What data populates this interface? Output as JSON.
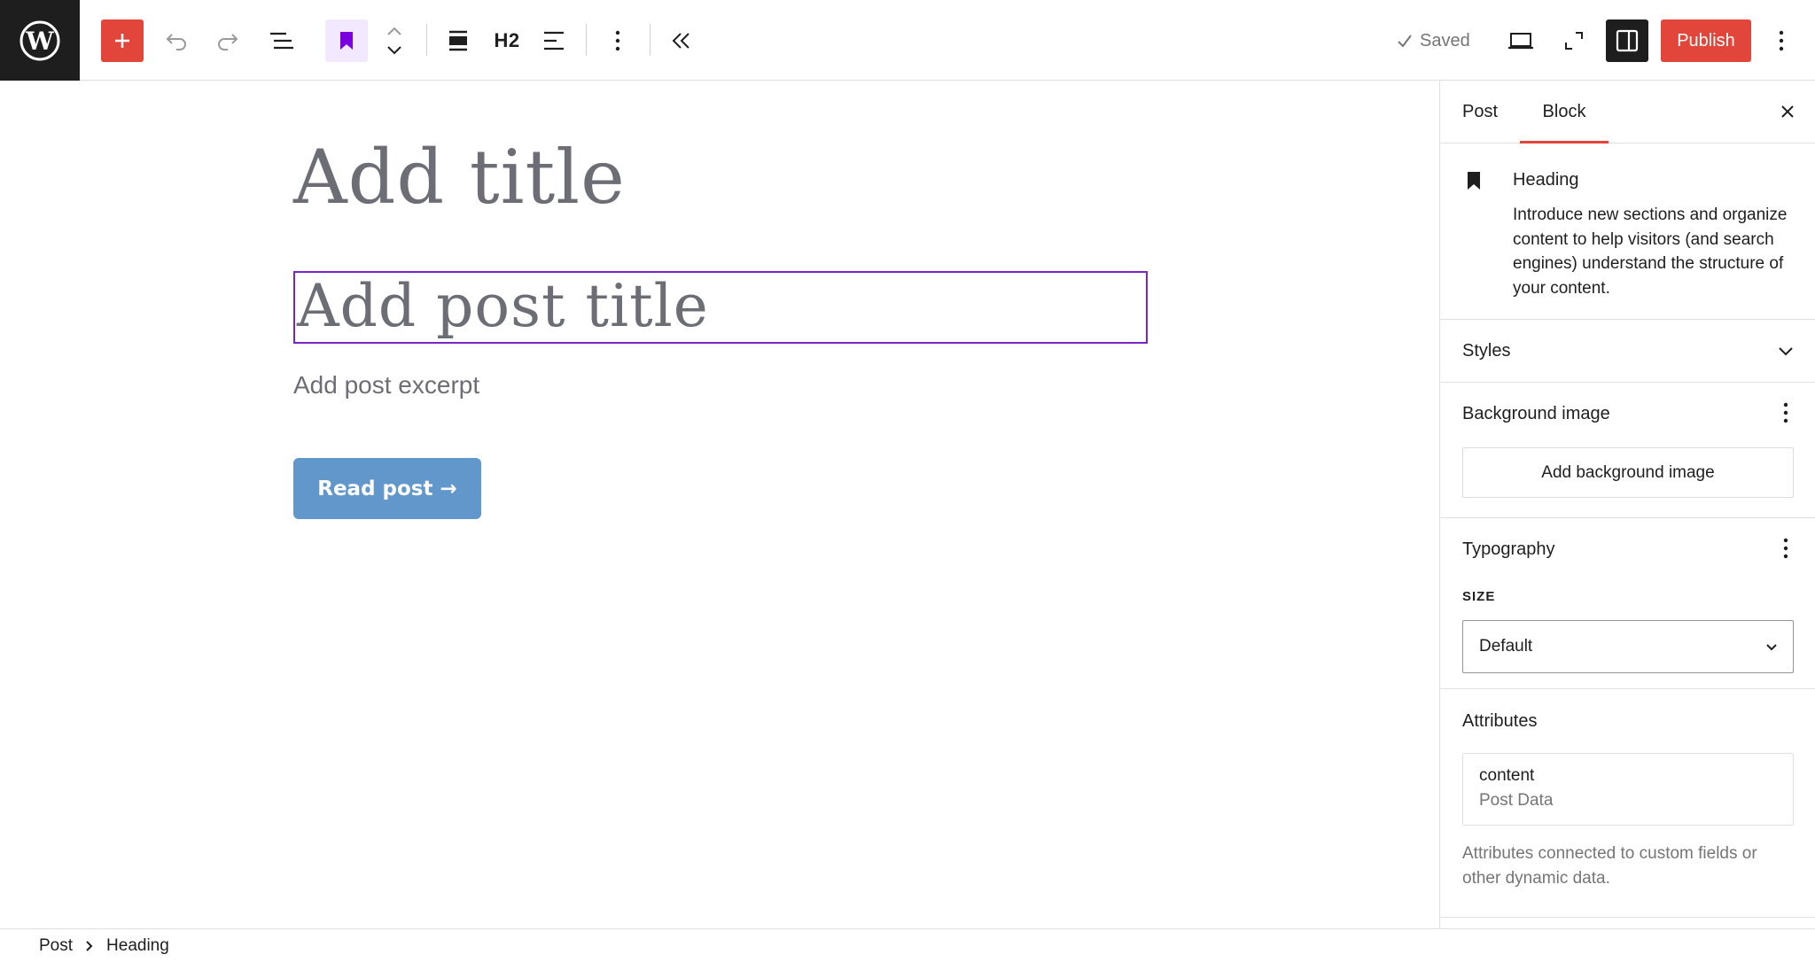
{
  "toolbar": {
    "add_block_icon": "plus-icon",
    "undo_icon": "undo-icon",
    "redo_icon": "redo-icon",
    "document_overview_icon": "list-view-icon",
    "block_type_icon": "bookmark-icon",
    "heading_level": "H2",
    "saved_label": "Saved",
    "publish_label": "Publish",
    "accent_color": "#e2463a"
  },
  "editor": {
    "title_placeholder": "Add title",
    "heading_placeholder": "Add post title",
    "excerpt_placeholder": "Add post excerpt",
    "read_button_label": "Read post →",
    "selection_color": "#7a23c8",
    "button_color": "#6297cb"
  },
  "sidebar": {
    "tabs": [
      {
        "label": "Post",
        "active": false
      },
      {
        "label": "Block",
        "active": true
      }
    ],
    "block_card": {
      "title": "Heading",
      "description": "Introduce new sections and organize content to help visitors (and search engines) understand the structure of your content."
    },
    "styles": {
      "title": "Styles"
    },
    "background_image": {
      "title": "Background image",
      "button_label": "Add background image"
    },
    "typography": {
      "title": "Typography",
      "size_label": "SIZE",
      "size_value": "Default"
    },
    "attributes": {
      "title": "Attributes",
      "name": "content",
      "source": "Post Data",
      "help": "Attributes connected to custom fields or other dynamic data."
    }
  },
  "footer": {
    "breadcrumb": [
      "Post",
      "Heading"
    ]
  }
}
